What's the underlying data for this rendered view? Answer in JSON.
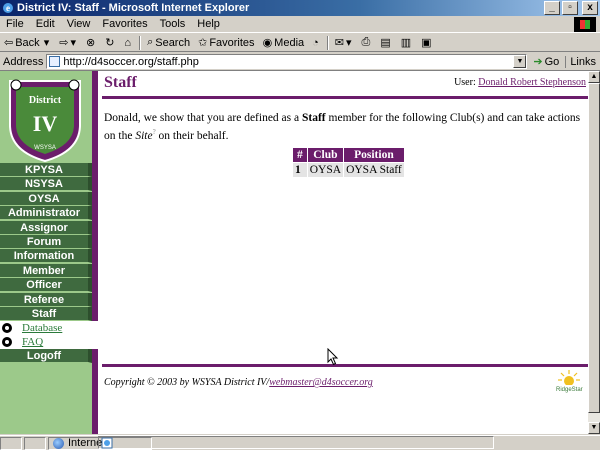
{
  "window": {
    "title": "District IV: Staff - Microsoft Internet Explorer",
    "controls": {
      "minimize": "_",
      "maximize": "▫",
      "close": "x"
    }
  },
  "menu": [
    "File",
    "Edit",
    "View",
    "Favorites",
    "Tools",
    "Help"
  ],
  "toolbar": {
    "back": "Back",
    "search": "Search",
    "favorites": "Favorites",
    "media": "Media"
  },
  "address": {
    "label": "Address",
    "url": "http://d4soccer.org/staff.php",
    "go": "Go",
    "links": "Links"
  },
  "logo": {
    "top_text": "District",
    "roman": "IV",
    "bottom_text": "WSYSA"
  },
  "sidebar": {
    "items": [
      {
        "label": "KPYSA"
      },
      {
        "label": "NSYSA"
      },
      {
        "label": "OYSA"
      },
      {
        "label": "Administrator"
      },
      {
        "label": "Assignor"
      },
      {
        "label": "Forum"
      },
      {
        "label": "Information"
      },
      {
        "label": "Member"
      },
      {
        "label": "Officer"
      },
      {
        "label": "Referee"
      },
      {
        "label": "Staff"
      }
    ],
    "subitems": [
      {
        "label": "Database"
      },
      {
        "label": "FAQ"
      }
    ],
    "logoff": "Logoff"
  },
  "page": {
    "heading": "Staff",
    "user_label": "User:",
    "user_name": "Donald Robert Stephenson",
    "message_part1": "Donald, we show that you are defined as a ",
    "message_bold": "Staff",
    "message_part2": " member for the following Club(s) and can take actions on the ",
    "message_site": "Site",
    "message_part3": " on their behalf.",
    "help_mark": "?"
  },
  "clubs_table": {
    "headers": [
      "#",
      "Club",
      "Position"
    ],
    "rows": [
      [
        "1",
        "OYSA",
        "OYSA Staff"
      ]
    ]
  },
  "footer": {
    "copyright": "Copyright © 2003 by WSYSA District IV/",
    "email": "webmaster@d4soccer.org",
    "sponsor": "RidgeStar"
  },
  "statusbar": {
    "zone": "Internet"
  },
  "colors": {
    "accent_purple": "#6b1d6b",
    "nav_green": "#3f6a3f",
    "sidebar_green": "#9cc98a"
  }
}
